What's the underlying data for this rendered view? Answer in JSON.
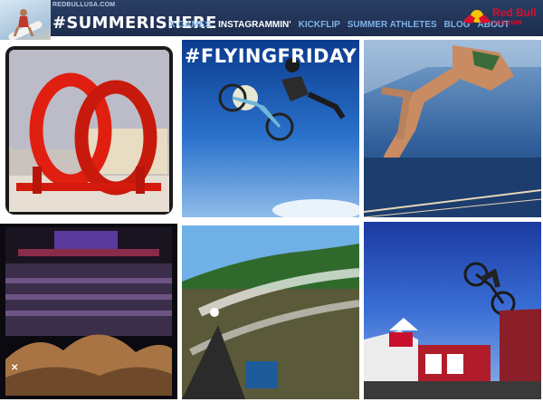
{
  "header": {
    "site_url": "REDBULLUSA.COM",
    "hashtag": "#SUMMERISHERE",
    "nav": [
      {
        "label": "X GAMES",
        "active": false
      },
      {
        "label": "INSTAGRAMMIN'",
        "active": true
      },
      {
        "label": "KICKFLIP",
        "active": false
      },
      {
        "label": "SUMMER ATHLETES",
        "active": false
      },
      {
        "label": "BLOG",
        "active": false
      },
      {
        "label": "ABOUT",
        "active": false
      }
    ],
    "logo": {
      "brand": "Red Bull",
      "sub": "usa.com"
    }
  },
  "photos": {
    "flying_friday_caption": "#FLYINGFRIDAY"
  },
  "colors": {
    "header_bg": "#1f3050",
    "nav_link": "#7fb2e6",
    "nav_active": "#ffffff",
    "brand_red": "#d8102d"
  }
}
